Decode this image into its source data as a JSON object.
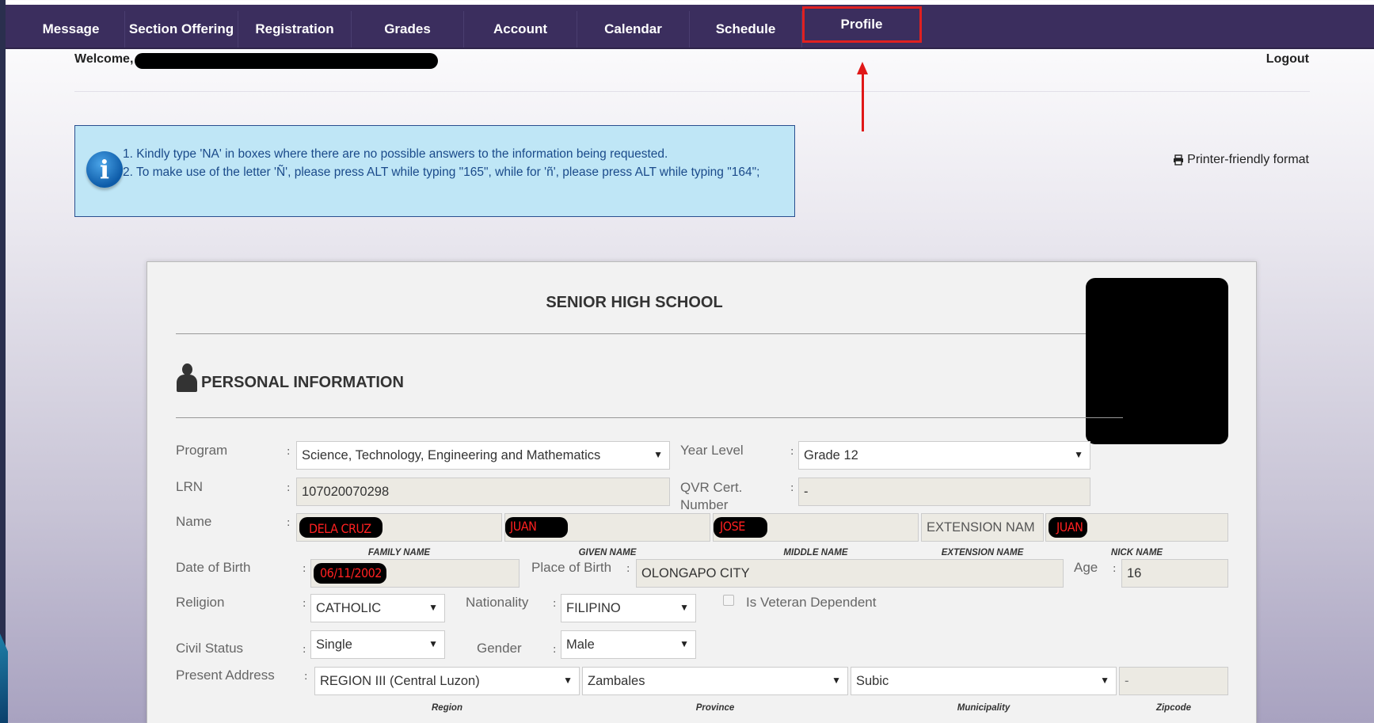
{
  "nav": {
    "items": [
      "Message",
      "Section Offering",
      "Registration",
      "Grades",
      "Account",
      "Calendar",
      "Schedule",
      "Profile"
    ],
    "active": "Profile"
  },
  "header": {
    "welcome": "Welcome,",
    "logout": "Logout",
    "printer": "Printer-friendly format"
  },
  "notice": {
    "line1": "1. Kindly type 'NA' in boxes where there are no possible answers to the information being requested.",
    "line2": "2. To make use of the letter 'Ñ', please press ALT while typing \"165\", while for 'ñ', please press ALT while typing \"164\";"
  },
  "form": {
    "title": "SENIOR HIGH SCHOOL",
    "section": "PERSONAL INFORMATION",
    "labels": {
      "program": "Program",
      "year_level": "Year Level",
      "lrn": "LRN",
      "qvr": "QVR Cert.\nNumber",
      "name": "Name",
      "dob": "Date of Birth",
      "pob": "Place of Birth",
      "age": "Age",
      "religion": "Religion",
      "nationality": "Nationality",
      "veteran": "Is Veteran Dependent",
      "civil_status": "Civil Status",
      "gender": "Gender",
      "present_address": "Present Address"
    },
    "values": {
      "program": "Science, Technology, Engineering and Mathematics",
      "year_level": "Grade 12",
      "lrn": "107020070298",
      "qvr": "-",
      "family_name": "DELA CRUZ",
      "given_name": "JUAN",
      "middle_name": "JOSE",
      "extension": "EXTENSION NAM",
      "nick_name": "JUAN",
      "dob": "06/11/2002",
      "pob": "OLONGAPO CITY",
      "age": "16",
      "religion": "CATHOLIC",
      "nationality": "FILIPINO",
      "civil_status": "Single",
      "gender": "Male",
      "region": "REGION III (Central Luzon)",
      "province": "Zambales",
      "municipality": "Subic",
      "zipcode": "-"
    },
    "hints": {
      "family": "FAMILY NAME",
      "given": "GIVEN NAME",
      "middle": "MIDDLE NAME",
      "extension": "EXTENSION NAME",
      "nick": "NICK NAME",
      "region": "Region",
      "province": "Province",
      "municipality": "Municipality",
      "zipcode": "Zipcode"
    }
  }
}
